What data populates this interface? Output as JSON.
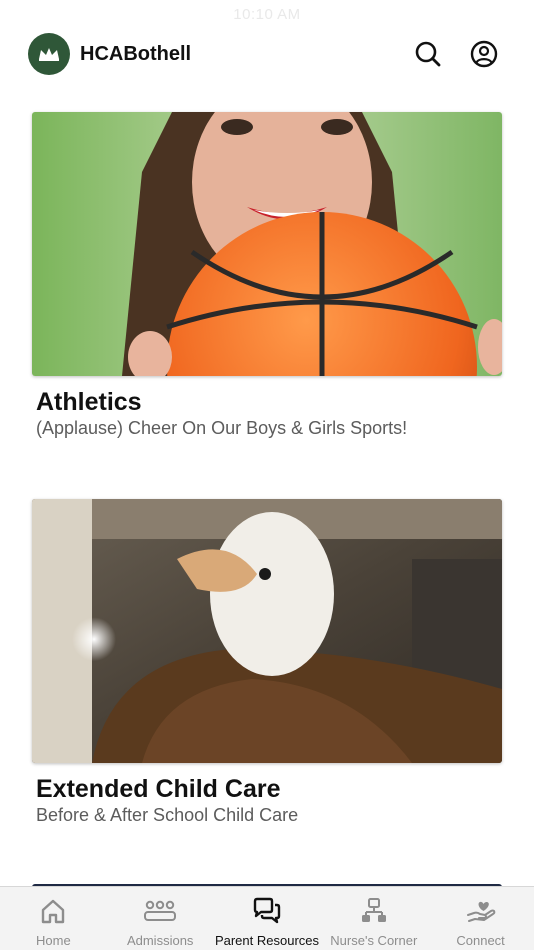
{
  "status_bar": {
    "time": "10:10 AM"
  },
  "header": {
    "title": "HCABothell",
    "logo_icon": "crown-icon",
    "search_icon": "search-icon",
    "account_icon": "user-circle-icon",
    "brand_color": "#2f5738"
  },
  "feed": {
    "cards": [
      {
        "title": "Athletics",
        "subtitle": "(Applause) Cheer On Our Boys & Girls Sports!",
        "image": "photo of smiling woman holding a basketball"
      },
      {
        "title": "Extended Child Care",
        "subtitle": "Before & After School Child Care",
        "image": "photo of eagle mascot costume"
      }
    ]
  },
  "tab_bar": {
    "active": "Parent Resources",
    "tabs": [
      {
        "label": "Home",
        "icon": "home-icon"
      },
      {
        "label": "Admissions",
        "icon": "group-icon"
      },
      {
        "label": "Parent Resources",
        "icon": "chat-bubbles-icon"
      },
      {
        "label": "Nurse's Corner",
        "icon": "org-chart-icon"
      },
      {
        "label": "Connect",
        "icon": "hand-heart-icon"
      }
    ]
  },
  "colors": {
    "text": "#111111",
    "subtitle": "#5c5c5c",
    "tab_inactive": "#8d8d8d",
    "tab_bar_bg": "#f3f3f3"
  }
}
